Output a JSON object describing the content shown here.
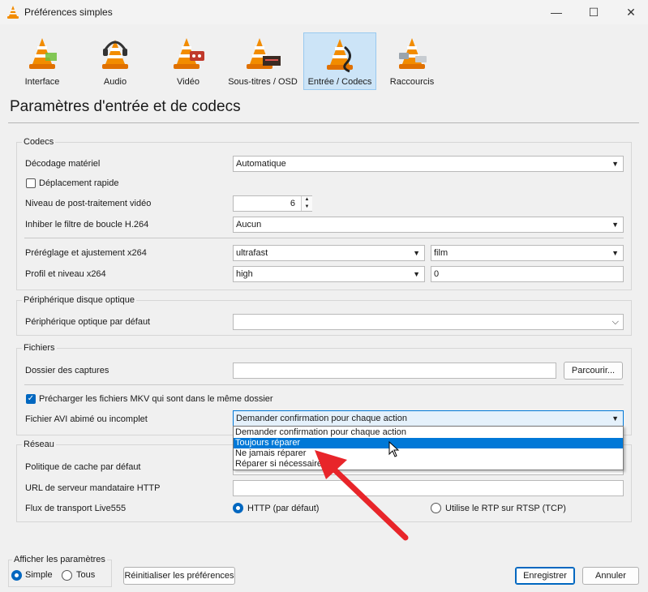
{
  "window": {
    "title": "Préférences simples",
    "controls": [
      "—",
      "☐",
      "✕"
    ]
  },
  "categories": [
    {
      "label": "Interface",
      "icon": "cone-interface-icon",
      "selected": false
    },
    {
      "label": "Audio",
      "icon": "cone-headphones-icon",
      "selected": false
    },
    {
      "label": "Vidéo",
      "icon": "cone-video-icon",
      "selected": false
    },
    {
      "label": "Sous-titres / OSD",
      "icon": "cone-subtitles-icon",
      "selected": false
    },
    {
      "label": "Entrée / Codecs",
      "icon": "cone-cable-icon",
      "selected": true
    },
    {
      "label": "Raccourcis",
      "icon": "cone-hotkeys-icon",
      "selected": false
    }
  ],
  "page_title": "Paramètres d'entrée et de codecs",
  "codecs": {
    "title": "Codecs",
    "hw_decoding_label": "Décodage matériel",
    "hw_decoding_value": "Automatique",
    "fast_seek_label": "Déplacement rapide",
    "postproc_label": "Niveau de post-traitement vidéo",
    "postproc_value": "6",
    "h264_loop_label": "Inhiber le filtre de boucle H.264",
    "h264_loop_value": "Aucun",
    "x264_preset_label": "Préréglage et ajustement x264",
    "x264_preset_value": "ultrafast",
    "x264_tune_value": "film",
    "x264_profile_label": "Profil et niveau x264",
    "x264_profile_value": "high",
    "x264_level_value": "0"
  },
  "optical": {
    "title": "Périphérique disque optique",
    "device_label": "Périphérique optique par défaut",
    "device_value": ""
  },
  "files": {
    "title": "Fichiers",
    "capture_dir_label": "Dossier des captures",
    "capture_dir_value": "",
    "browse_label": "Parcourir...",
    "preload_mkv_label": "Précharger les fichiers MKV qui sont dans le même dossier",
    "avi_label": "Fichier AVI abimé ou incomplet",
    "avi_value": "Demander confirmation pour chaque action",
    "avi_options": [
      "Demander confirmation pour chaque action",
      "Toujours réparer",
      "Ne jamais réparer",
      "Réparer si nécessaire"
    ],
    "avi_highlighted_index": 1
  },
  "network": {
    "title": "Réseau",
    "cache_label": "Politique de cache par défaut",
    "proxy_label": "URL de serveur mandataire HTTP",
    "proxy_value": "",
    "live555_label": "Flux de transport Live555",
    "live555_http": "HTTP (par défaut)",
    "live555_rtsp": "Utilise le RTP sur RTSP (TCP)"
  },
  "footer": {
    "show_settings_title": "Afficher les paramètres",
    "simple_label": "Simple",
    "all_label": "Tous",
    "reset_label": "Réinitialiser les préférences",
    "save_label": "Enregistrer",
    "cancel_label": "Annuler"
  },
  "colors": {
    "accent": "#0078d7",
    "arrow": "#e8252a",
    "selected_tab": "#cce4f7"
  }
}
